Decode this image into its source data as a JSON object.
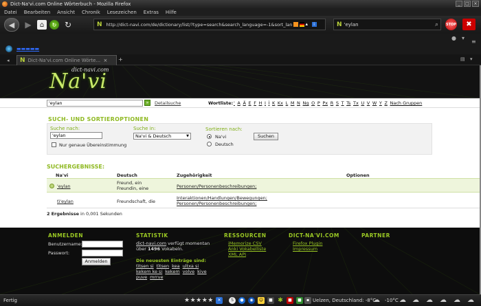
{
  "window": {
    "title": "Dict-Na'vi.com Online Wörterbuch - Mozilla Firefox",
    "controls": [
      "_",
      "□",
      "×"
    ]
  },
  "menu": [
    "Datei",
    "Bearbeiten",
    "Ansicht",
    "Chronik",
    "Lesezeichen",
    "Extras",
    "Hilfe"
  ],
  "nav": {
    "url": "http://dict-navi.com/de/dictionary/list/?type=search&search_language=-1&sort_languag",
    "site_glyph": "N",
    "search_value": "'eylan",
    "stop_label": "STOP",
    "block_label": "✖"
  },
  "tabs": [
    {
      "label": "Dict-Na'vi.com Online Wörte...",
      "icon": "N"
    }
  ],
  "site": {
    "logo_small": "dict-navi.com",
    "logo_text": "Na'vi",
    "search_value": "'eylan",
    "search_go": "»",
    "detail_search": "Detailsuche",
    "wordlist_label": "Wortliste:",
    "letters": [
      "'",
      "A",
      "Ä",
      "E",
      "F",
      "H",
      "I",
      "Ì",
      "K",
      "Kx",
      "L",
      "M",
      "N",
      "Ng",
      "O",
      "P",
      "Px",
      "R",
      "S",
      "T",
      "Ts",
      "Tx",
      "U",
      "V",
      "W",
      "Y",
      "Z"
    ],
    "by_groups": "Nach Gruppen"
  },
  "options": {
    "title": "SUCH- UND SORTIEROPTIONEN",
    "search_for_label": "Suche nach:",
    "search_for_value": "'eylan",
    "exact_match": "Nur genaue Übereinstimmung",
    "search_in_label": "Suche in:",
    "search_in_value": "Na'vi & Deutsch",
    "sort_label": "Sortieren nach:",
    "sort_options": [
      "Na'vi",
      "Deutsch"
    ],
    "search_button": "Suchen"
  },
  "results": {
    "title": "SUCHERGEBNISSE:",
    "columns": [
      "Na'vi",
      "Deutsch",
      "Zugehörigkeit",
      "Optionen"
    ],
    "rows": [
      {
        "navi": "'eylan",
        "deutsch_1": "Freund, ein",
        "deutsch_2": "Freundin, eine",
        "group_1": "Personen/Personenbeschreibungen;",
        "group_2": ""
      },
      {
        "navi": "tì'eylan",
        "deutsch_1": "Freundschaft, die",
        "deutsch_2": "",
        "group_1": "Interaktionen/Handlungen/Bewegungen;",
        "group_2": "Personen/Personenbeschreibungen;"
      }
    ],
    "count_num": "2",
    "count_word": "Ergebnisse",
    "count_rest": " in 0,001 Sekunden"
  },
  "footer": {
    "login_title": "ANMELDEN",
    "username_label": "Benutzername:",
    "password_label": "Passwort:",
    "login_button": "Anmelden",
    "stats_title": "STATISTIK",
    "stats_link": "dict-navi.com",
    "stats_text_1": " verfügt momentan",
    "stats_text_2": "über ",
    "stats_count": "1496",
    "stats_text_3": " Vokabeln.",
    "newest_title": "Die neuesten Einträge sind:",
    "newest_line_1": [
      "tìtsen si",
      "tìtsen",
      "kea",
      "ultxa si"
    ],
    "newest_line_2": [
      "kekem ke si",
      "kekem",
      "volve",
      "kive"
    ],
    "newest_line_3": [
      "puve",
      "mrrve"
    ],
    "resources_title": "RESSOURCEN",
    "resources": [
      "iMemorize CSV",
      "Anki Vokabelliste",
      "XML API"
    ],
    "dict_title": "DICT-NA'VI.COM",
    "dict_links": [
      "Firefox Plugin",
      "Impressum"
    ],
    "partner_title": "PARTNER"
  },
  "status": {
    "text": "Fertig",
    "stars": "★★★★★",
    "weather_text": "Uelzen, Deutschland: -8°C",
    "temp_2": "-10°C"
  }
}
